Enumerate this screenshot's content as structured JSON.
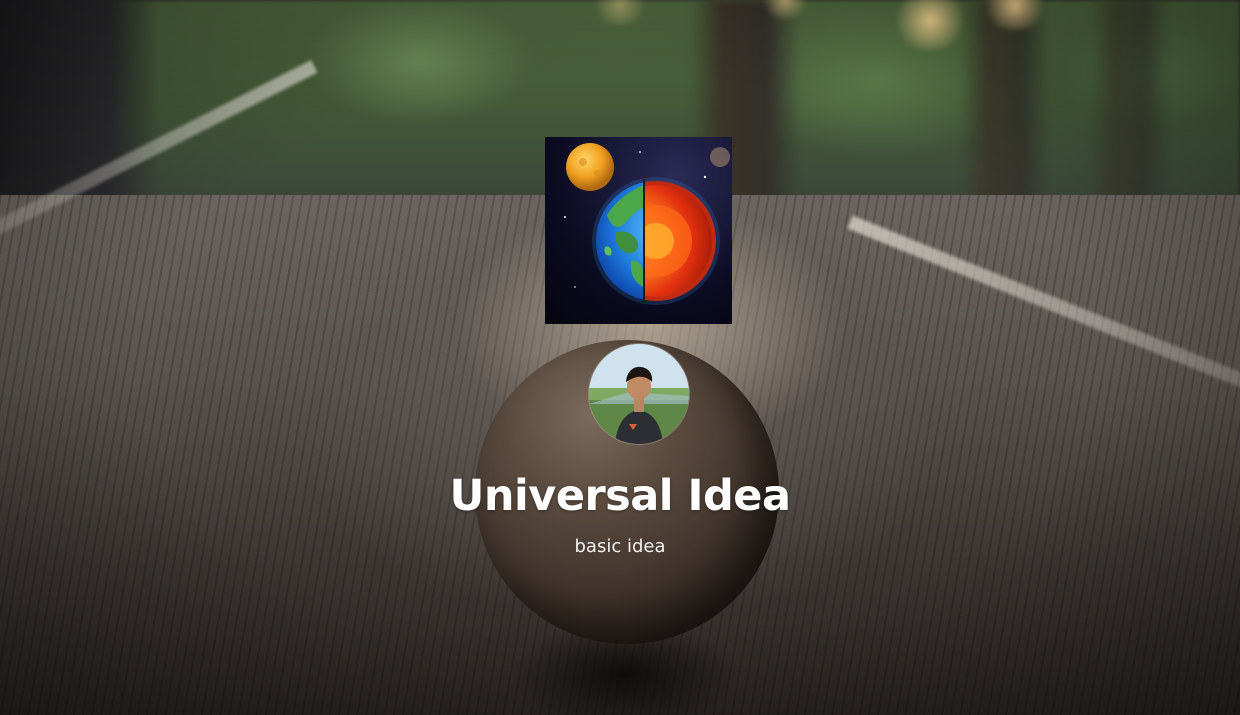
{
  "profile": {
    "name": "Universal Idea",
    "bio": "basic idea",
    "logo_icon": "earth-cross-section-icon",
    "avatar_icon": "profile-photo"
  },
  "theme": {
    "text_color": "#ffffff",
    "subtitle_color": "#f2f2f2"
  }
}
